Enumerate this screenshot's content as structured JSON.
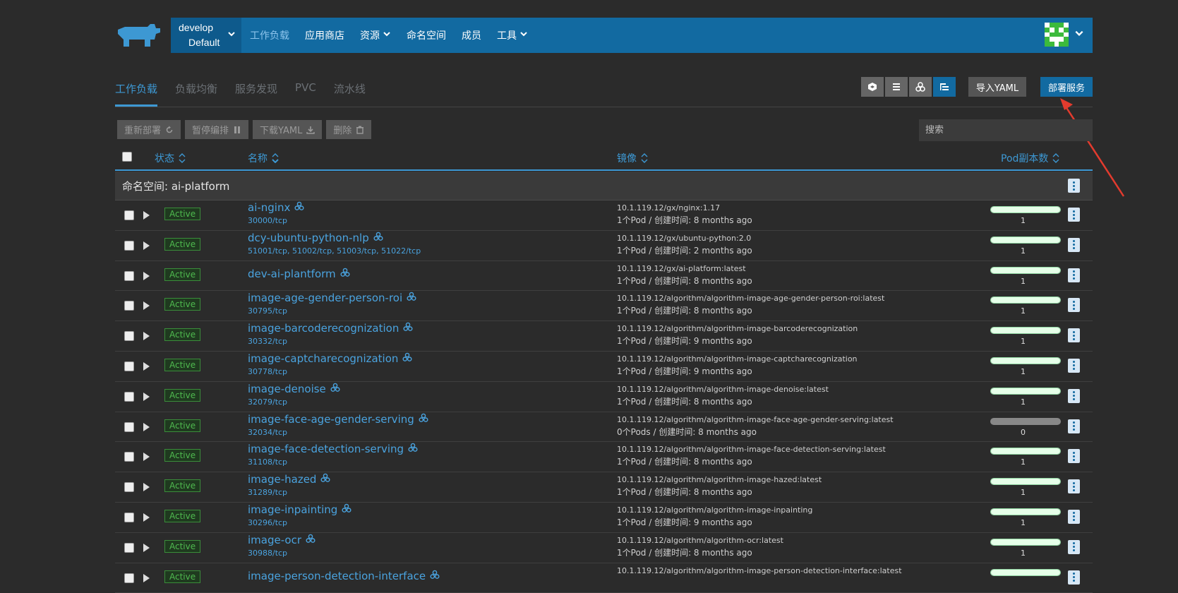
{
  "nav": {
    "env_name": "develop",
    "env_sub": "Default",
    "items": [
      {
        "label": "工作负载",
        "active": true
      },
      {
        "label": "应用商店",
        "active": false
      },
      {
        "label": "资源",
        "active": false,
        "dropdown": true
      },
      {
        "label": "命名空间",
        "active": false
      },
      {
        "label": "成员",
        "active": false
      },
      {
        "label": "工具",
        "active": false,
        "dropdown": true
      }
    ]
  },
  "subtabs": [
    "工作负载",
    "负载均衡",
    "服务发现",
    "PVC",
    "流水线"
  ],
  "toolbar": {
    "import_yaml": "导入YAML",
    "deploy": "部署服务",
    "redeploy": "重新部署",
    "pause": "暂停编排",
    "download_yaml": "下载YAML",
    "delete": "删除",
    "search_placeholder": "搜索"
  },
  "table": {
    "headers": {
      "state": "状态",
      "name": "名称",
      "image": "镜像",
      "pods": "Pod副本数"
    },
    "namespace_label": "命名空间: ai-platform",
    "rows": [
      {
        "name": "ai-nginx",
        "ports": [
          "30000/tcp"
        ],
        "image": "10.1.119.12/gx/nginx:1.17",
        "pods": "1个Pod",
        "created": "创建时间: 8 months ago",
        "count": "1",
        "state": "Active",
        "fill": 1
      },
      {
        "name": "dcy-ubuntu-python-nlp",
        "ports": [
          "51001/tcp",
          "51002/tcp",
          "51003/tcp",
          "51022/tcp"
        ],
        "image": "10.1.119.12/gx/ubuntu-python:2.0",
        "pods": "1个Pod",
        "created": "创建时间: 2 months ago",
        "count": "1",
        "state": "Active",
        "fill": 1
      },
      {
        "name": "dev-ai-plantform",
        "ports": [],
        "image": "10.1.119.12/gx/ai-platform:latest",
        "pods": "1个Pod",
        "created": "创建时间: 8 months ago",
        "count": "1",
        "state": "Active",
        "fill": 1
      },
      {
        "name": "image-age-gender-person-roi",
        "ports": [
          "30795/tcp"
        ],
        "image": "10.1.119.12/algorithm/algorithm-image-age-gender-person-roi:latest",
        "pods": "1个Pod",
        "created": "创建时间: 8 months ago",
        "count": "1",
        "state": "Active",
        "fill": 1
      },
      {
        "name": "image-barcoderecognization",
        "ports": [
          "30332/tcp"
        ],
        "image": "10.1.119.12/algorithm/algorithm-image-barcoderecognization",
        "pods": "1个Pod",
        "created": "创建时间: 9 months ago",
        "count": "1",
        "state": "Active",
        "fill": 1
      },
      {
        "name": "image-captcharecognization",
        "ports": [
          "30778/tcp"
        ],
        "image": "10.1.119.12/algorithm/algorithm-image-captcharecognization",
        "pods": "1个Pod",
        "created": "创建时间: 9 months ago",
        "count": "1",
        "state": "Active",
        "fill": 1
      },
      {
        "name": "image-denoise",
        "ports": [
          "32079/tcp"
        ],
        "image": "10.1.119.12/algorithm/algorithm-image-denoise:latest",
        "pods": "1个Pod",
        "created": "创建时间: 8 months ago",
        "count": "1",
        "state": "Active",
        "fill": 1
      },
      {
        "name": "image-face-age-gender-serving",
        "ports": [
          "32034/tcp"
        ],
        "image": "10.1.119.12/algorithm/algorithm-image-face-age-gender-serving:latest",
        "pods": "0个Pods",
        "created": "创建时间: 8 months ago",
        "count": "0",
        "state": "Active",
        "fill": 0
      },
      {
        "name": "image-face-detection-serving",
        "ports": [
          "31108/tcp"
        ],
        "image": "10.1.119.12/algorithm/algorithm-image-face-detection-serving:latest",
        "pods": "1个Pod",
        "created": "创建时间: 8 months ago",
        "count": "1",
        "state": "Active",
        "fill": 1
      },
      {
        "name": "image-hazed",
        "ports": [
          "31289/tcp"
        ],
        "image": "10.1.119.12/algorithm/algorithm-image-hazed:latest",
        "pods": "1个Pod",
        "created": "创建时间: 8 months ago",
        "count": "1",
        "state": "Active",
        "fill": 1
      },
      {
        "name": "image-inpainting",
        "ports": [
          "30296/tcp"
        ],
        "image": "10.1.119.12/algorithm/algorithm-image-inpainting",
        "pods": "1个Pod",
        "created": "创建时间: 9 months ago",
        "count": "1",
        "state": "Active",
        "fill": 1
      },
      {
        "name": "image-ocr",
        "ports": [
          "30988/tcp"
        ],
        "image": "10.1.119.12/algorithm/algorithm-ocr:latest",
        "pods": "1个Pod",
        "created": "创建时间: 8 months ago",
        "count": "1",
        "state": "Active",
        "fill": 1
      },
      {
        "name": "image-person-detection-interface",
        "ports": [],
        "image": "10.1.119.12/algorithm/algorithm-image-person-detection-interface:latest",
        "pods": "",
        "created": "",
        "count": "",
        "state": "Active",
        "fill": 1
      }
    ]
  },
  "colors": {
    "nav": "#126aa1",
    "accent": "#3d98d3",
    "active_badge": "#4fb94f",
    "annotation_arrow": "#e33b2e"
  }
}
